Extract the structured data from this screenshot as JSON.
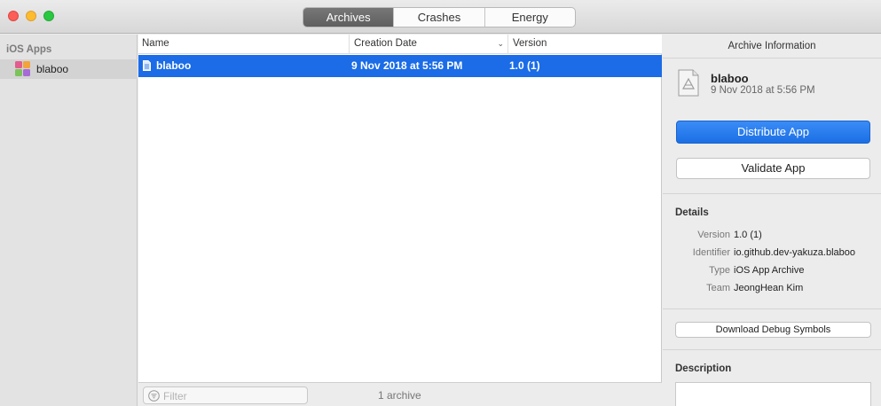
{
  "window": {
    "tabs": [
      {
        "label": "Archives",
        "active": true
      },
      {
        "label": "Crashes",
        "active": false
      },
      {
        "label": "Energy",
        "active": false
      }
    ]
  },
  "sidebar": {
    "heading": "iOS Apps",
    "items": [
      {
        "label": "blaboo",
        "icon": "app-icon",
        "selected": true
      }
    ]
  },
  "table": {
    "columns": [
      "Name",
      "Creation Date",
      "Version"
    ],
    "sort_icon": "chevron-down-icon",
    "rows": [
      {
        "name": "blaboo",
        "date": "9 Nov 2018 at 5:56 PM",
        "version": "1.0 (1)",
        "selected": true
      }
    ]
  },
  "footer": {
    "filter_placeholder": "Filter",
    "count": "1 archive"
  },
  "inspector": {
    "title": "Archive Information",
    "archive_name": "blaboo",
    "archive_date": "9 Nov 2018 at 5:56 PM",
    "distribute_label": "Distribute App",
    "validate_label": "Validate App",
    "details_heading": "Details",
    "details": [
      {
        "key": "Version",
        "value": "1.0 (1)"
      },
      {
        "key": "Identifier",
        "value": "io.github.dev-yakuza.blaboo"
      },
      {
        "key": "Type",
        "value": "iOS App Archive"
      },
      {
        "key": "Team",
        "value": "JeongHean Kim"
      }
    ],
    "debug_symbols_label": "Download Debug Symbols",
    "description_heading": "Description"
  },
  "colors": {
    "accent": "#1b6ce6",
    "close": "#fc5f57",
    "minimize": "#fdbc2e",
    "zoom": "#28c840"
  }
}
